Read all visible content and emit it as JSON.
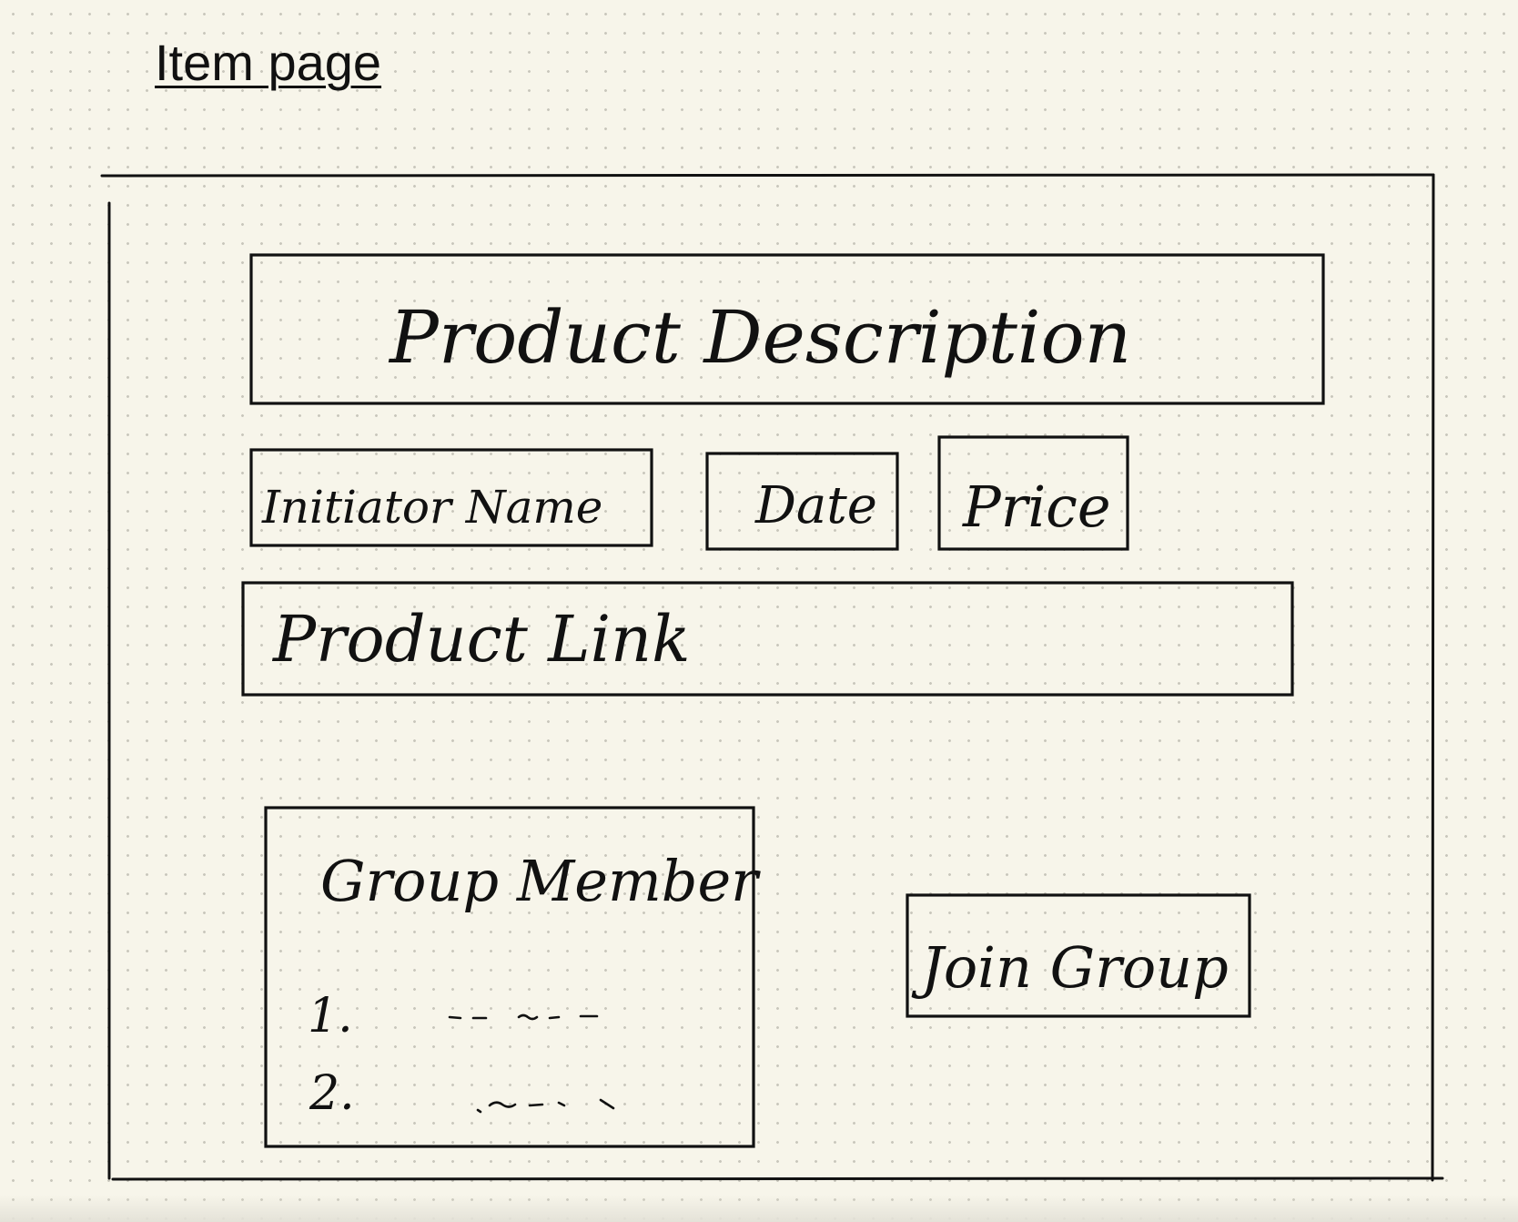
{
  "page": {
    "title": "Item page"
  },
  "frame": {
    "product_description": "Product Description",
    "initiator_name": "Initiator Name",
    "date": "Date",
    "price": "Price",
    "product_link": "Product Link",
    "group_member": {
      "heading": "Group Member",
      "items": [
        {
          "number": "1."
        },
        {
          "number": "2."
        }
      ]
    },
    "join_group": "Join Group"
  },
  "colors": {
    "paper": "#f7f5ea",
    "dot": "#c9c7bc",
    "ink": "#111111"
  }
}
